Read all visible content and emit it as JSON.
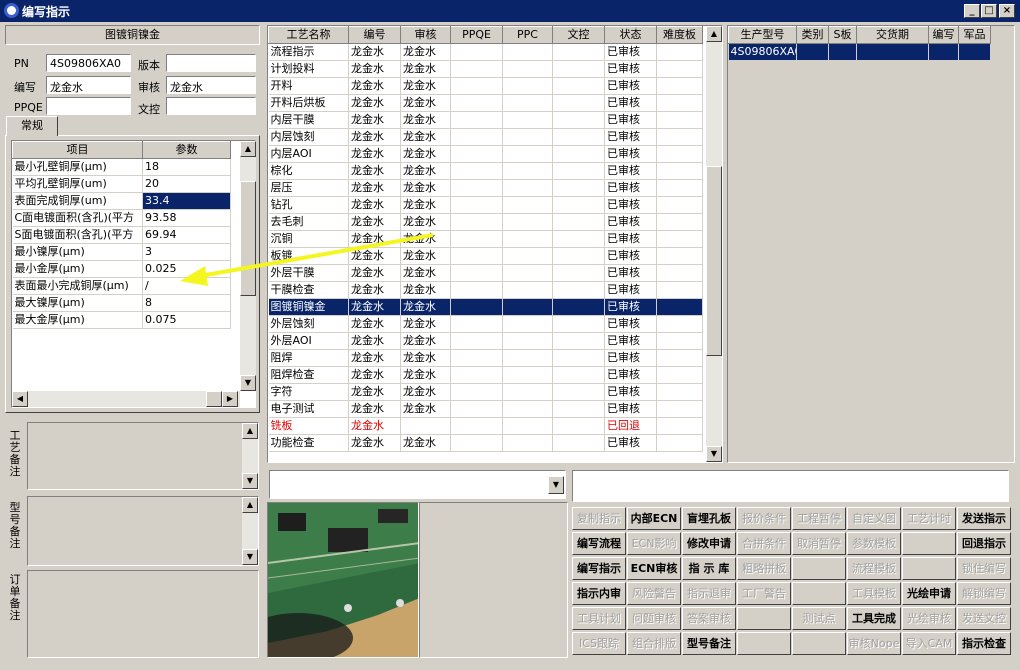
{
  "window": {
    "title": "编写指示",
    "min": "_",
    "max": "□",
    "close": "×"
  },
  "left": {
    "section_title": "图镀铜镍金",
    "pn_label": "PN",
    "pn_value": "4S09806XA0",
    "version_label": "版本",
    "version_value": "",
    "writer_label": "编写",
    "writer_value": "龙金水",
    "reviewer_label": "审核",
    "reviewer_value": "龙金水",
    "ppqe_label": "PPQE",
    "ppqe_value": "",
    "wenkong_label": "文控",
    "wenkong_value": "",
    "tab": "常规",
    "param_headers": [
      "项目",
      "参数"
    ],
    "params": [
      {
        "item": "最小孔壁铜厚(μm)",
        "value": "18"
      },
      {
        "item": "平均孔壁铜厚(um)",
        "value": "20"
      },
      {
        "item": "表面完成铜厚(um)",
        "value": "33.4"
      },
      {
        "item": "C面电镀面积(含孔)(平方",
        "value": "93.58"
      },
      {
        "item": "S面电镀面积(含孔)(平方",
        "value": "69.94"
      },
      {
        "item": "最小镍厚(μm)",
        "value": "3"
      },
      {
        "item": "最小金厚(μm)",
        "value": "0.025"
      },
      {
        "item": "表面最小完成铜厚(μm)",
        "value": "/"
      },
      {
        "item": "最大镍厚(μm)",
        "value": "8"
      },
      {
        "item": "最大金厚(μm)",
        "value": "0.075"
      }
    ],
    "selected_param": 2,
    "notes": {
      "process": "工艺备注",
      "model": "型号备注",
      "order": "订单备注"
    }
  },
  "process": {
    "headers": [
      "工艺名称",
      "编号",
      "审核",
      "PPQE",
      "PPC",
      "文控",
      "状态",
      "难度板"
    ],
    "rows": [
      {
        "name": "流程指示",
        "writer": "龙金水",
        "reviewer": "龙金水",
        "status": "已审核"
      },
      {
        "name": "计划投料",
        "writer": "龙金水",
        "reviewer": "龙金水",
        "status": "已审核"
      },
      {
        "name": "开料",
        "writer": "龙金水",
        "reviewer": "龙金水",
        "status": "已审核"
      },
      {
        "name": "开料后烘板",
        "writer": "龙金水",
        "reviewer": "龙金水",
        "status": "已审核"
      },
      {
        "name": "内层干膜",
        "writer": "龙金水",
        "reviewer": "龙金水",
        "status": "已审核"
      },
      {
        "name": "内层蚀刻",
        "writer": "龙金水",
        "reviewer": "龙金水",
        "status": "已审核"
      },
      {
        "name": "内层AOI",
        "writer": "龙金水",
        "reviewer": "龙金水",
        "status": "已审核"
      },
      {
        "name": "棕化",
        "writer": "龙金水",
        "reviewer": "龙金水",
        "status": "已审核"
      },
      {
        "name": "层压",
        "writer": "龙金水",
        "reviewer": "龙金水",
        "status": "已审核"
      },
      {
        "name": "钻孔",
        "writer": "龙金水",
        "reviewer": "龙金水",
        "status": "已审核"
      },
      {
        "name": "去毛刺",
        "writer": "龙金水",
        "reviewer": "龙金水",
        "status": "已审核"
      },
      {
        "name": "沉铜",
        "writer": "龙金水",
        "reviewer": "龙金水",
        "status": "已审核"
      },
      {
        "name": "板镀",
        "writer": "龙金水",
        "reviewer": "龙金水",
        "status": "已审核"
      },
      {
        "name": "外层干膜",
        "writer": "龙金水",
        "reviewer": "龙金水",
        "status": "已审核"
      },
      {
        "name": "干膜检查",
        "writer": "龙金水",
        "reviewer": "龙金水",
        "status": "已审核"
      },
      {
        "name": "图镀铜镍金",
        "writer": "龙金水",
        "reviewer": "龙金水",
        "status": "已审核"
      },
      {
        "name": "外层蚀刻",
        "writer": "龙金水",
        "reviewer": "龙金水",
        "status": "已审核"
      },
      {
        "name": "外层AOI",
        "writer": "龙金水",
        "reviewer": "龙金水",
        "status": "已审核"
      },
      {
        "name": "阻焊",
        "writer": "龙金水",
        "reviewer": "龙金水",
        "status": "已审核"
      },
      {
        "name": "阻焊检查",
        "writer": "龙金水",
        "reviewer": "龙金水",
        "status": "已审核"
      },
      {
        "name": "字符",
        "writer": "龙金水",
        "reviewer": "龙金水",
        "status": "已审核"
      },
      {
        "name": "电子测试",
        "writer": "龙金水",
        "reviewer": "龙金水",
        "status": "已审核"
      },
      {
        "name": "铣板",
        "writer": "龙金水",
        "reviewer": "",
        "status": "已回退"
      },
      {
        "name": "功能检查",
        "writer": "龙金水",
        "reviewer": "龙金水",
        "status": "已审核"
      }
    ],
    "selected": 15,
    "returned": 22
  },
  "orders": {
    "headers": [
      "生产型号",
      "类别",
      "S板",
      "交货期",
      "编写",
      "军品"
    ],
    "rows": [
      {
        "model": "4S09806XA0"
      }
    ]
  },
  "buttons": [
    [
      {
        "t": "复制指示",
        "e": false
      },
      {
        "t": "内部ECN",
        "e": true
      },
      {
        "t": "盲埋孔板",
        "e": true
      },
      {
        "t": "报价条件",
        "e": false
      },
      {
        "t": "工程暂停",
        "e": false
      },
      {
        "t": "自定义图",
        "e": false
      },
      {
        "t": "工艺计时",
        "e": false
      },
      {
        "t": "发送指示",
        "e": true
      }
    ],
    [
      {
        "t": "编写流程",
        "e": true
      },
      {
        "t": "ECN影响",
        "e": false
      },
      {
        "t": "修改申请",
        "e": true
      },
      {
        "t": "合拼条件",
        "e": false
      },
      {
        "t": "取消暂停",
        "e": false
      },
      {
        "t": "参数模板",
        "e": false
      },
      {
        "t": "",
        "e": false
      },
      {
        "t": "回退指示",
        "e": true
      }
    ],
    [
      {
        "t": "编写指示",
        "e": true
      },
      {
        "t": "ECN审核",
        "e": true
      },
      {
        "t": "指 示 库",
        "e": true
      },
      {
        "t": "粗略拼板",
        "e": false
      },
      {
        "t": "",
        "e": false
      },
      {
        "t": "流程模板",
        "e": false
      },
      {
        "t": "",
        "e": false
      },
      {
        "t": "锁住编写",
        "e": false
      }
    ],
    [
      {
        "t": "指示内审",
        "e": true
      },
      {
        "t": "风险警告",
        "e": false
      },
      {
        "t": "指示退审",
        "e": false
      },
      {
        "t": "工厂警告",
        "e": false
      },
      {
        "t": "",
        "e": false
      },
      {
        "t": "工具模板",
        "e": false
      },
      {
        "t": "光绘申请",
        "e": true
      },
      {
        "t": "解锁编写",
        "e": false
      }
    ],
    [
      {
        "t": "工具计划",
        "e": false
      },
      {
        "t": "问题审核",
        "e": false
      },
      {
        "t": "答案审核",
        "e": false
      },
      {
        "t": "",
        "e": false
      },
      {
        "t": "测试点",
        "e": false
      },
      {
        "t": "工具完成",
        "e": true
      },
      {
        "t": "光绘审核",
        "e": false
      },
      {
        "t": "发送文控",
        "e": false
      }
    ],
    [
      {
        "t": "ICS跟踪",
        "e": false
      },
      {
        "t": "组合排版",
        "e": false
      },
      {
        "t": "型号备注",
        "e": true
      },
      {
        "t": "",
        "e": false
      },
      {
        "t": "",
        "e": false
      },
      {
        "t": "审核Nope",
        "e": false
      },
      {
        "t": "导入CAM",
        "e": false
      },
      {
        "t": "指示检查",
        "e": true
      }
    ]
  ]
}
